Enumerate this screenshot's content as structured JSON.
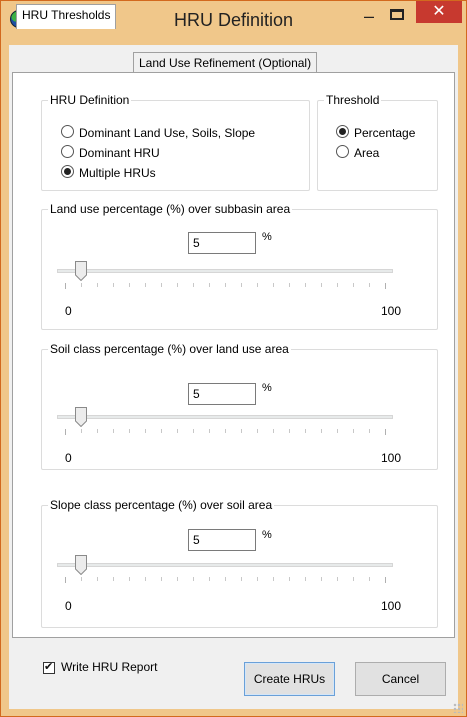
{
  "window": {
    "title": "HRU Definition",
    "minimize": "–",
    "close": "✕"
  },
  "tabs": [
    {
      "label": "HRU Thresholds",
      "selected": true
    },
    {
      "label": "Land Use Refinement (Optional)",
      "selected": false
    }
  ],
  "hru_definition": {
    "label": "HRU Definition",
    "options": [
      {
        "label": "Dominant Land Use, Soils, Slope",
        "selected": false
      },
      {
        "label": "Dominant HRU",
        "selected": false
      },
      {
        "label": "Multiple HRUs",
        "selected": true
      }
    ]
  },
  "threshold": {
    "label": "Threshold",
    "options": [
      {
        "label": "Percentage",
        "selected": true
      },
      {
        "label": "Area",
        "selected": false
      }
    ]
  },
  "land_use": {
    "label": "Land use percentage (%) over subbasin area",
    "value": "5",
    "unit": "%",
    "min_label": "0",
    "max_label": "100",
    "slider_value": 5
  },
  "soil": {
    "label": "Soil class percentage (%) over land use area",
    "value": "5",
    "unit": "%",
    "min_label": "0",
    "max_label": "100",
    "slider_value": 5
  },
  "slope": {
    "label": "Slope class percentage (%) over soil area",
    "value": "5",
    "unit": "%",
    "min_label": "0",
    "max_label": "100",
    "slider_value": 5
  },
  "footer": {
    "write_report_label": "Write HRU Report",
    "write_report_checked": true,
    "create_label": "Create HRUs",
    "cancel_label": "Cancel"
  }
}
